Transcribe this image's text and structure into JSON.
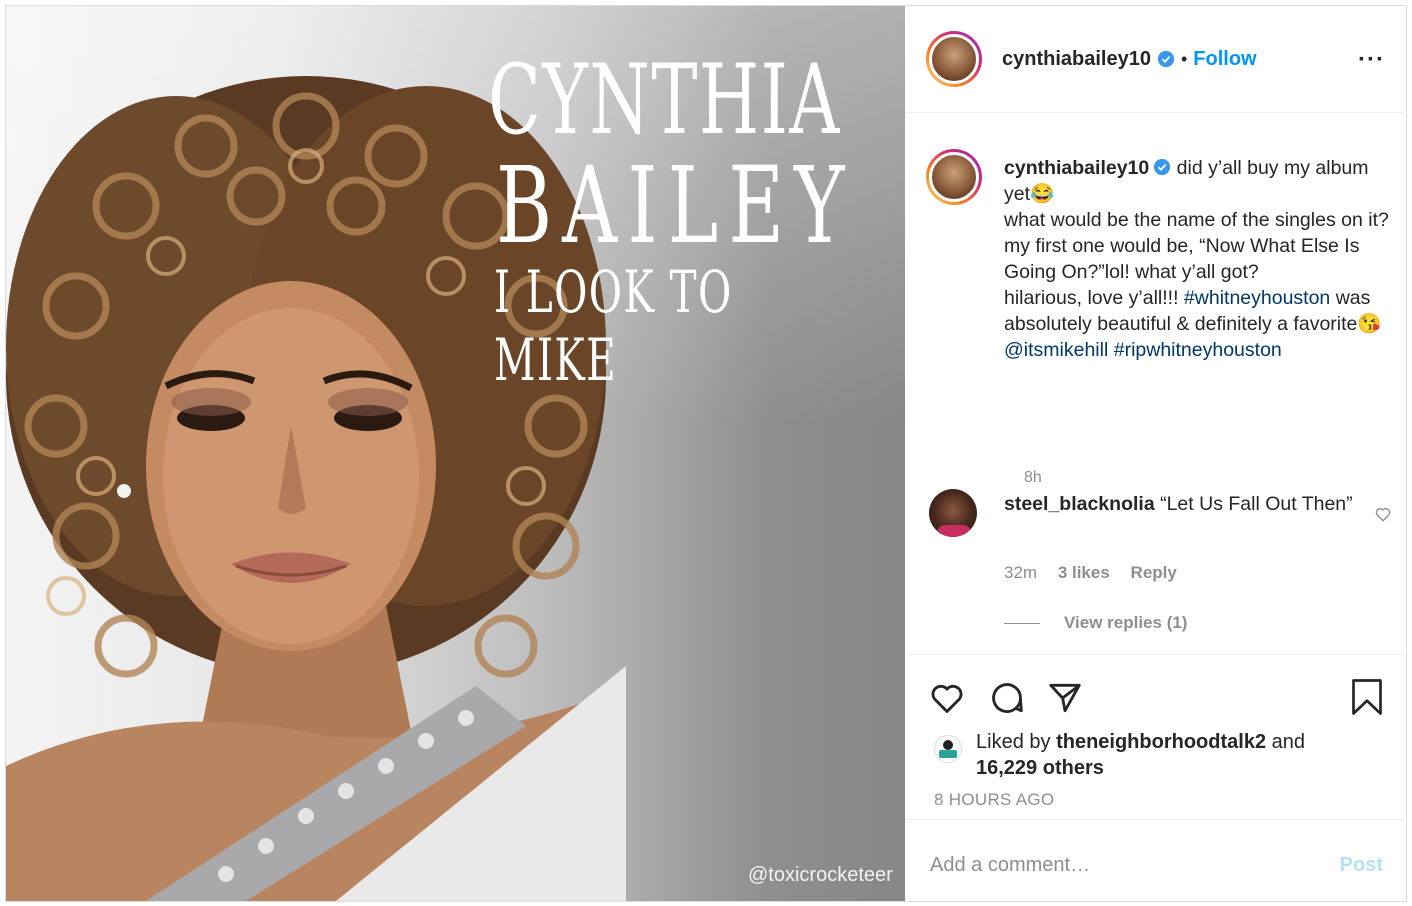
{
  "media": {
    "cover_line1": "CYNTHIA",
    "cover_line2": "BAILEY",
    "cover_line3": "I LOOK TO MIKE",
    "watermark": "@toxicrocketeer"
  },
  "header": {
    "username": "cynthiabailey10",
    "separator": "•",
    "follow_label": "Follow",
    "more_label": "···"
  },
  "caption": {
    "username": "cynthiabailey10",
    "text_1": " did y’all buy my album yet😂",
    "text_2": "what would be the name of the singles on it? my first one would be, “Now What Else Is Going On?”lol! what y’all got?",
    "text_3": "hilarious, love y’all!!! ",
    "hashtag_1": "#whitneyhouston",
    "text_4": " was absolutely beautiful & definitely a favorite😘",
    "mention": "@itsmikehill",
    "hashtag_2": "#ripwhitneyhouston",
    "time": "8h"
  },
  "comment": {
    "username": "steel_blacknolia",
    "text": " “Let Us Fall Out Then”",
    "time": "32m",
    "likes": "3 likes",
    "reply_label": "Reply",
    "view_replies": "View replies (1)"
  },
  "actions": {
    "liked_by_prefix": "Liked by ",
    "liked_by_user": "theneighborhoodtalk2",
    "liked_by_and": " and",
    "others": "16,229 others",
    "time_ago": "8 HOURS AGO"
  },
  "add_comment": {
    "placeholder": "Add a comment…",
    "post_label": "Post"
  },
  "colors": {
    "link": "#00376b",
    "follow": "#0095f6",
    "post_disabled": "#b2dffc",
    "muted": "#8e8e8e"
  }
}
